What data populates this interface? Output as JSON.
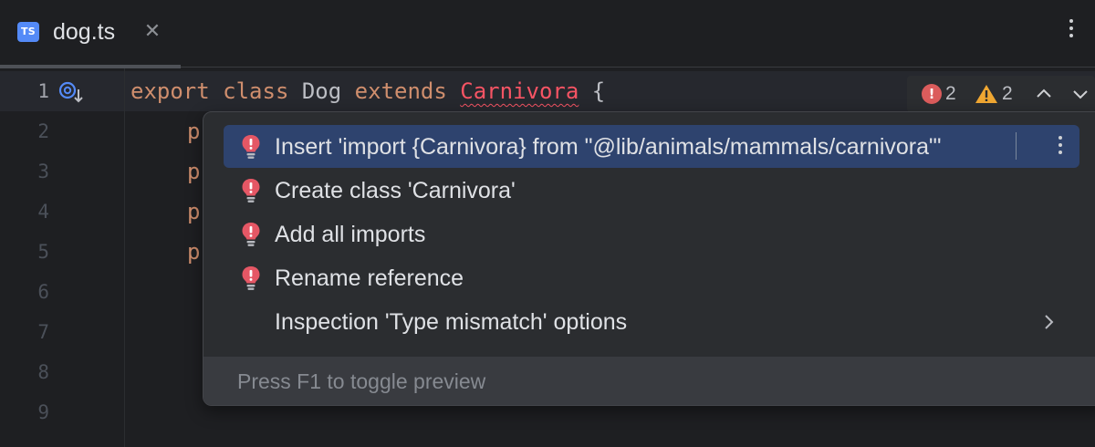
{
  "tab": {
    "file_badge": "TS",
    "file_name": "dog.ts"
  },
  "editor": {
    "line_numbers": [
      "1",
      "2",
      "3",
      "4",
      "5",
      "6",
      "7",
      "8",
      "9"
    ],
    "code_line_1": {
      "export_kw": "export",
      "class_kw": "class",
      "class_name": "Dog",
      "extends_kw": "extends",
      "parent_class": "Carnivora",
      "brace": "{"
    },
    "truncated_lines": [
      "p",
      "p",
      "p",
      "p"
    ]
  },
  "inspections": {
    "error_count": "2",
    "warning_count": "2",
    "error_color": "#db5c5c",
    "warning_color": "#f0a732"
  },
  "intention_popup": {
    "items": [
      {
        "label": "Insert 'import {Carnivora} from \"@lib/animals/mammals/carnivora\"'",
        "icon": "error-bulb-icon",
        "selected": true
      },
      {
        "label": "Create class 'Carnivora'",
        "icon": "error-bulb-icon",
        "selected": false
      },
      {
        "label": "Add all imports",
        "icon": "error-bulb-icon",
        "selected": false
      },
      {
        "label": "Rename reference",
        "icon": "error-bulb-icon",
        "selected": false
      },
      {
        "label": "Inspection 'Type mismatch' options",
        "icon": "chevron-right-icon",
        "selected": false
      }
    ],
    "footer_hint": "Press F1 to toggle preview"
  },
  "colors": {
    "background": "#1e1f22",
    "popup_background": "#2b2d30",
    "selection": "#2e436e",
    "keyword": "#cf8e6d",
    "error": "#f75464",
    "ts_badge": "#548af7"
  }
}
